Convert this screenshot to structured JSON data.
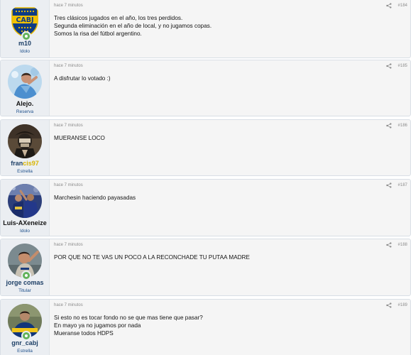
{
  "colors": {
    "post_bg": "#f5f5f5",
    "user_column_bg": "#ebeef2",
    "border": "#d8dee5",
    "username": "#1d3f66",
    "role": "#1d4f8a",
    "meta": "#8c8c8c",
    "online": "#63b35b",
    "highlight_yellow": "#d8b400"
  },
  "posts": [
    {
      "username": "m10",
      "role": "Idolo",
      "online": true,
      "avatar_icon": "boca-crest-avatar",
      "time": "hace 7 minutos",
      "number": "#184",
      "lines": [
        "Tres clásicos jugados en el año, los tres perdidos.",
        "Segunda eliminación en el año de local, y no jugamos copas.",
        "Somos la risa del fútbol argentino."
      ]
    },
    {
      "username": "Alejo.",
      "role": "Reserva",
      "online": false,
      "avatar_icon": "player-photo-avatar",
      "time": "hace 7 minutos",
      "number": "#185",
      "lines": [
        "A disfrutar lo votado :)"
      ]
    },
    {
      "username_part1": "fran",
      "username_part2": "cis97",
      "role": "Estrella",
      "online": false,
      "avatar_icon": "masked-figure-avatar",
      "time": "hace 7 minutos",
      "number": "#186",
      "lines": [
        "MUERANSE LOCO"
      ]
    },
    {
      "username": "Luis-AXeneize",
      "role": "Idolo",
      "online": false,
      "avatar_icon": "celebration-photo-avatar",
      "time": "hace 7 minutos",
      "number": "#187",
      "lines": [
        "Marchesin haciendo payasadas"
      ]
    },
    {
      "username": "jorge comas",
      "role": "Titular",
      "online": true,
      "avatar_icon": "player-celebrating-avatar",
      "time": "hace 7 minutos",
      "number": "#188",
      "lines": [
        "POR QUE NO TE VAS UN POCO A LA RECONCHADE TU PUTAA MADRE"
      ]
    },
    {
      "username": "gnr_cabj",
      "role": "Estrella",
      "online": true,
      "avatar_icon": "team-jersey-avatar",
      "time": "hace 7 minutos",
      "number": "#189",
      "lines": [
        "Si esto no es tocar fondo no se que mas tiene que pasar?",
        "En mayo ya no jugamos por nada",
        "Mueranse todos HDPS"
      ]
    }
  ]
}
